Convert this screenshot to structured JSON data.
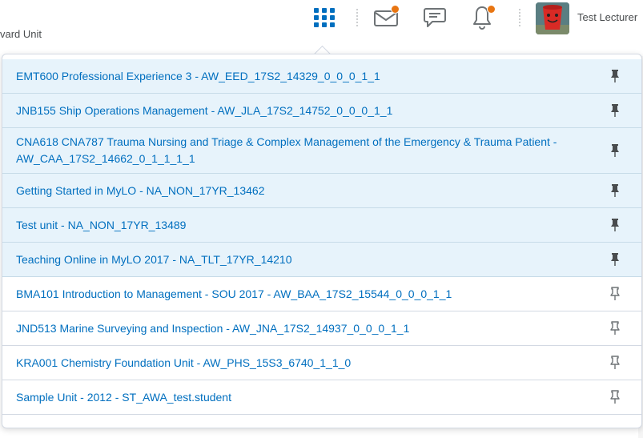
{
  "background": {
    "partial_title": "vard Unit"
  },
  "topbar": {
    "user_name": "Test Lecturer",
    "icons": [
      "grid-icon",
      "mail-icon",
      "chat-icon",
      "bell-icon"
    ],
    "accent_color": "#006fbf",
    "notification_color": "#e87511"
  },
  "courses": [
    {
      "label": "EMT600 Professional Experience 3 - AW_EED_17S2_14329_0_0_0_1_1",
      "pinned": true
    },
    {
      "label": "JNB155 Ship Operations Management - AW_JLA_17S2_14752_0_0_0_1_1",
      "pinned": true
    },
    {
      "label": "CNA618 CNA787 Trauma Nursing and Triage & Complex Management of the Emergency & Trauma Patient - AW_CAA_17S2_14662_0_1_1_1_1",
      "pinned": true
    },
    {
      "label": "Getting Started in MyLO - NA_NON_17YR_13462",
      "pinned": true
    },
    {
      "label": "Test unit - NA_NON_17YR_13489",
      "pinned": true
    },
    {
      "label": "Teaching Online in MyLO 2017 - NA_TLT_17YR_14210",
      "pinned": true
    },
    {
      "label": "BMA101 Introduction to Management - SOU 2017 - AW_BAA_17S2_15544_0_0_0_1_1",
      "pinned": false
    },
    {
      "label": "JND513 Marine Surveying and Inspection - AW_JNA_17S2_14937_0_0_0_1_1",
      "pinned": false
    },
    {
      "label": "KRA001 Chemistry Foundation Unit - AW_PHS_15S3_6740_1_1_0",
      "pinned": false
    },
    {
      "label": "Sample Unit - 2012 - ST_AWA_test.student",
      "pinned": false
    }
  ]
}
